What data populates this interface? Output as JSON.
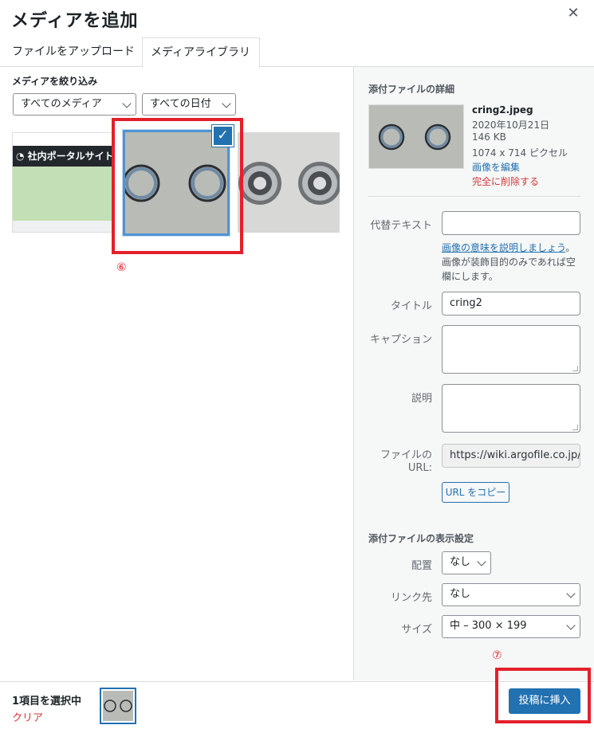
{
  "modal": {
    "title": "メディアを追加",
    "close_icon": "close-icon"
  },
  "tabs": [
    {
      "label": "ファイルをアップロード",
      "active": false
    },
    {
      "label": "メディアライブラリ",
      "active": true
    }
  ],
  "filter": {
    "label": "メディアを絞り込み",
    "type_select": "すべてのメディア",
    "date_select": "すべての日付"
  },
  "library": {
    "thumb1_text": "社内ポータルサイト",
    "annotation_select": "⑥"
  },
  "details": {
    "heading": "添付ファイルの詳細",
    "filename": "cring2.jpeg",
    "date": "2020年10月21日",
    "size": "146 KB",
    "dimensions": "1074 x 714 ピクセル",
    "edit_link": "画像を編集",
    "delete_link": "完全に削除する",
    "alt_label": "代替テキスト",
    "alt_value": "",
    "alt_help_link": "画像の意味を説明しましょう",
    "alt_help_link_tail": "。",
    "alt_help_text_1": "画像が装飾目的のみであれば空",
    "alt_help_text_2": "欄にします。",
    "title_label": "タイトル",
    "title_value": "cring2",
    "caption_label": "キャプション",
    "description_label": "説明",
    "url_label_1": "ファイルの",
    "url_label_2": "URL:",
    "url_value": "https://wiki.argofile.co.jp/w",
    "copy_button": "URL をコピー"
  },
  "display_settings": {
    "heading": "添付ファイルの表示設定",
    "align_label": "配置",
    "align_value": "なし",
    "link_label": "リンク先",
    "link_value": "なし",
    "size_label": "サイズ",
    "size_value": "中 – 300 × 199"
  },
  "toolbar": {
    "selection_count": "1項目を選択中",
    "clear_label": "クリア",
    "insert_button": "投稿に挿入",
    "annotation_insert": "⑦"
  },
  "colors": {
    "accent": "#2271b1",
    "danger": "#d63638",
    "annotation": "#e3202a"
  }
}
